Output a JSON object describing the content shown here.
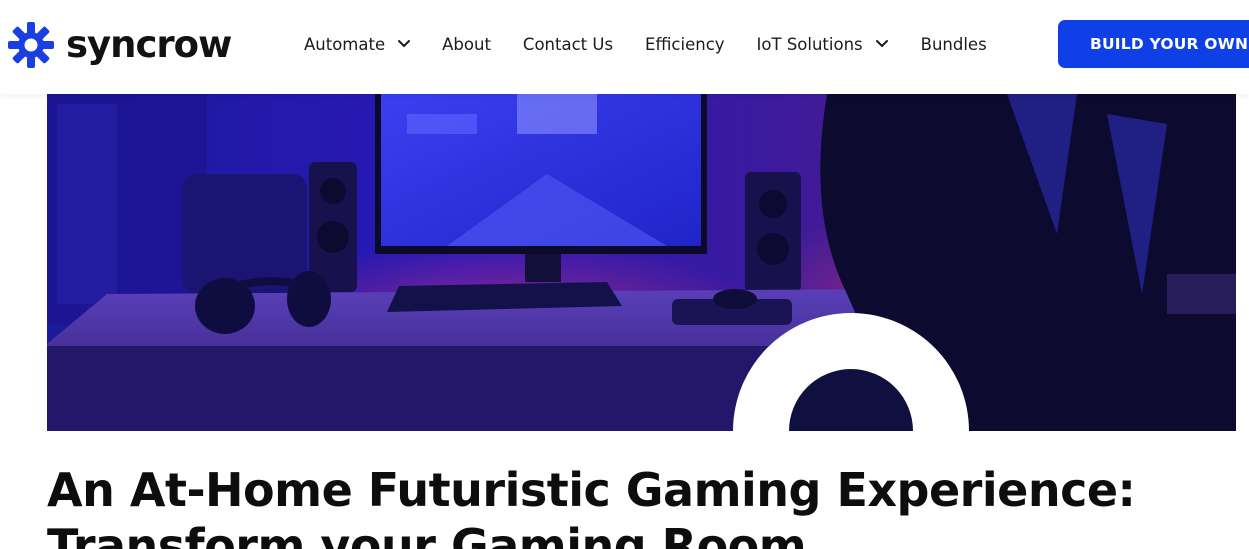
{
  "brand": {
    "name": "syncrow",
    "logo_icon": "gear-icon",
    "logo_color": "#1a3fe0"
  },
  "nav": {
    "items": [
      {
        "label": "Automate",
        "has_dropdown": true
      },
      {
        "label": "About",
        "has_dropdown": false
      },
      {
        "label": "Contact Us",
        "has_dropdown": false
      },
      {
        "label": "Efficiency",
        "has_dropdown": false
      },
      {
        "label": "IoT Solutions",
        "has_dropdown": true
      },
      {
        "label": "Bundles",
        "has_dropdown": false
      }
    ],
    "dropdown_icon": "chevron-down-icon"
  },
  "cta": {
    "label": "BUILD YOUR OWN",
    "color": "#0f3fe6"
  },
  "hero": {
    "image_subject": "gaming setup with monitor, speakers, headphones, keyboard and gaming chair in blue and purple light"
  },
  "article": {
    "title": "An At-Home Futuristic Gaming Experience: Transform your Gaming Room"
  }
}
